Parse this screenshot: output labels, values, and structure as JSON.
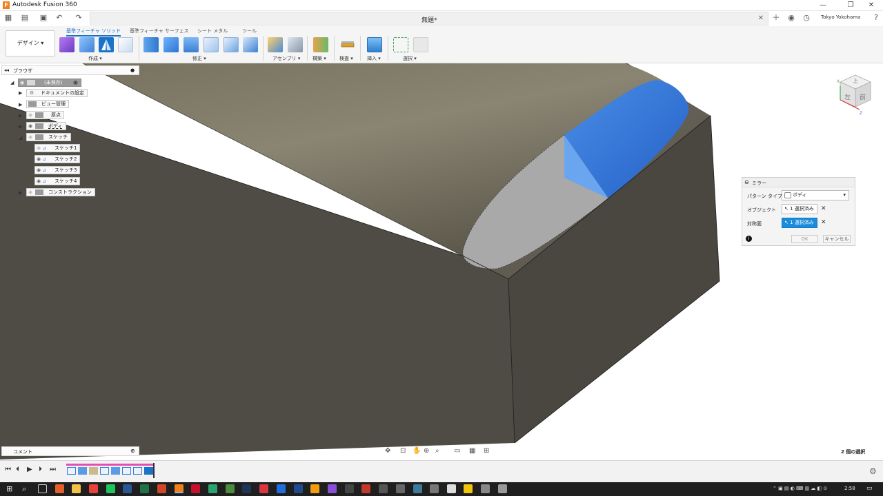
{
  "window": {
    "title": "Autodesk Fusion 360",
    "logo": "F",
    "document_title": "無題*",
    "user": "Tokyo Yokohama",
    "controls": {
      "minimize": "—",
      "restore": "❐",
      "close": "✕"
    }
  },
  "ribbon": {
    "workspace": "デザイン ▾",
    "tabs": [
      {
        "label": "基準フィーチャ ソリッド",
        "active": true
      },
      {
        "label": "基準フィーチャ サーフェス",
        "active": false
      },
      {
        "label": "シート メタル",
        "active": false
      },
      {
        "label": "ツール",
        "active": false
      }
    ],
    "groups": [
      {
        "label": "作成 ▾"
      },
      {
        "label": "修正 ▾"
      },
      {
        "label": "アセンブリ ▾"
      },
      {
        "label": "構築 ▾"
      },
      {
        "label": "検査 ▾"
      },
      {
        "label": "挿入 ▾"
      },
      {
        "label": "選択 ▾"
      }
    ]
  },
  "browser": {
    "title": "ブラウザ",
    "nodes": [
      {
        "label": "(未保存)"
      },
      {
        "label": "ドキュメントの設定"
      },
      {
        "label": "ビュー管理"
      },
      {
        "label": "原点"
      },
      {
        "label": "ボディ"
      },
      {
        "label": "スケッチ"
      },
      {
        "label": "スケッチ1"
      },
      {
        "label": "スケッチ2"
      },
      {
        "label": "スケッチ3"
      },
      {
        "label": "スケッチ4"
      },
      {
        "label": "コンストラクション"
      }
    ]
  },
  "dialog": {
    "title": "ミラー",
    "pattern_type_label": "パターン タイプ",
    "pattern_type_value": "ボディ",
    "object_label": "オブジェクト",
    "object_value": "1 選択済み",
    "plane_label": "対称面",
    "plane_value": "1 選択済み",
    "ok": "OK",
    "cancel": "キャンセル"
  },
  "bottom": {
    "comment_label": "コメント",
    "selection_status": "2 個の選択"
  },
  "viewcube": {
    "top": "上",
    "left": "左",
    "front": "前",
    "axis_x": "X",
    "axis_z": "Z"
  },
  "taskbar": {
    "time": "2:58"
  },
  "colors": {
    "accent": "#1a73c9",
    "model_dark": "#4d4a44",
    "selection_blue": "#2f6fd6"
  }
}
